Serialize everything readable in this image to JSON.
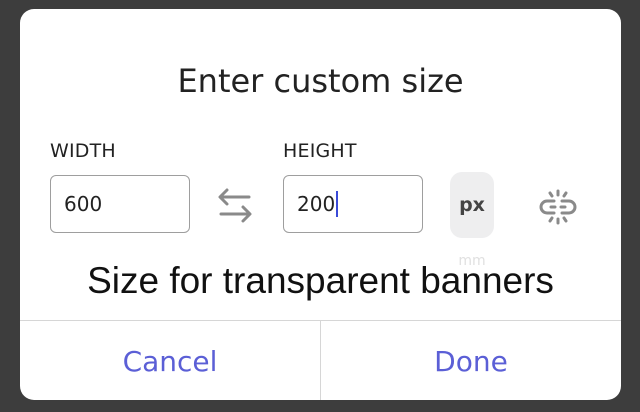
{
  "dialog": {
    "title": "Enter custom size",
    "width_label": "WIDTH",
    "height_label": "HEIGHT",
    "width_value": "600",
    "height_value": "200",
    "unit": "px",
    "unit_hint": "mm",
    "caption": "Size for transparent banners",
    "cancel_label": "Cancel",
    "done_label": "Done"
  },
  "icons": {
    "swap": "swap-arrows-icon",
    "link": "unlink-chain-icon"
  },
  "colors": {
    "accent": "#5b5fd6",
    "caret": "#3a4ad8",
    "backdrop": "#3d3d3d"
  }
}
